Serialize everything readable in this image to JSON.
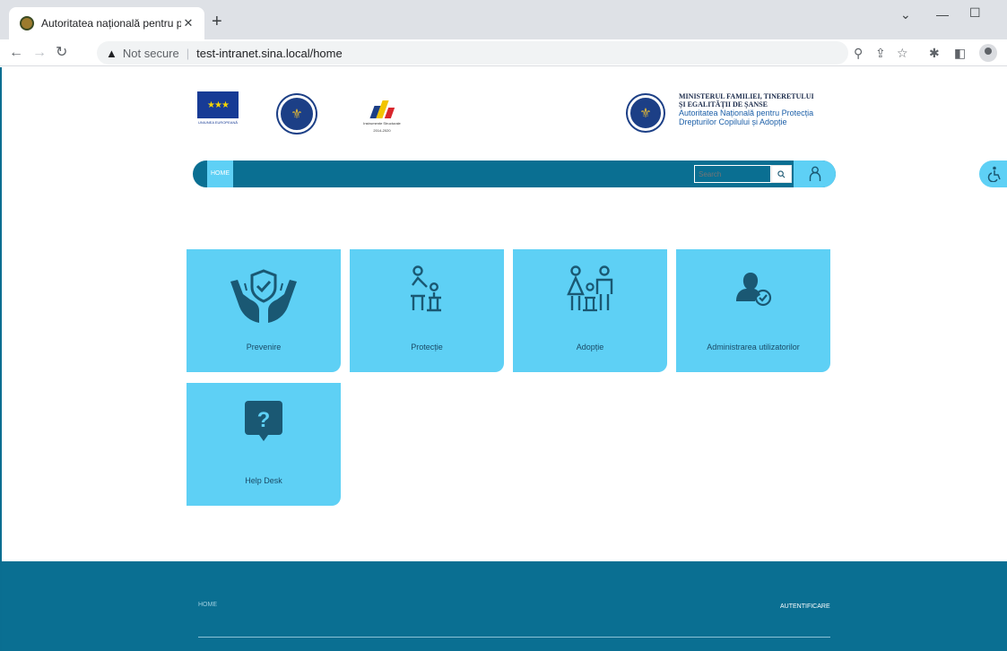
{
  "browser": {
    "tab_title": "Autoritatea națională pentru prot",
    "tab_close": "✕",
    "new_tab": "+",
    "security_label": "Not secure",
    "url": "test-intranet.sina.local/home"
  },
  "header": {
    "eu_caption": "UNIUNEA EUROPEANĂ",
    "pois_caption_1": "Instrumente Structurale",
    "pois_caption_2": "2014-2020",
    "ministry_line1": "MINISTERUL FAMILIEI, TINERETULUI",
    "ministry_line2": "ȘI EGALITĂȚII DE ȘANSE",
    "authority_line1": "Autoritatea Națională pentru Protecția",
    "authority_line2": "Drepturilor Copilului și Adopție"
  },
  "nav": {
    "home": "HOME",
    "search_placeholder": "Search"
  },
  "tiles": [
    {
      "label": "Prevenire",
      "icon": "hands-shield-icon"
    },
    {
      "label": "Protecție",
      "icon": "adult-child-icon"
    },
    {
      "label": "Adopție",
      "icon": "family-icon"
    },
    {
      "label": "Administrarea utilizatorilor",
      "icon": "user-admin-icon"
    },
    {
      "label": "Help Desk",
      "icon": "help-question-icon"
    }
  ],
  "footer": {
    "home": "HOME",
    "login": "AUTENTIFICARE"
  },
  "colors": {
    "brand_dark": "#0a6f92",
    "brand_light": "#5ed0f5",
    "icon": "#1a5873"
  }
}
